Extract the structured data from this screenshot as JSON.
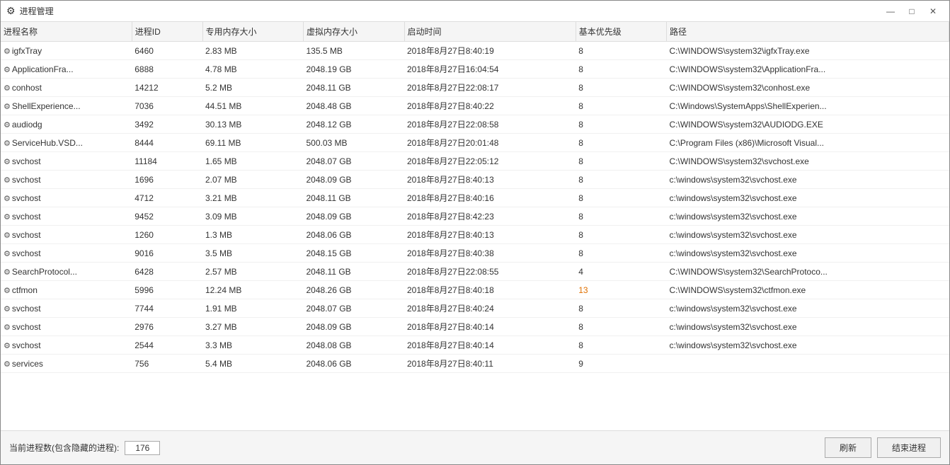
{
  "window": {
    "title": "进程管理",
    "title_icon": "⚙"
  },
  "title_controls": {
    "minimize": "—",
    "maximize": "□",
    "close": "✕"
  },
  "table": {
    "headers": [
      "进程名称",
      "进程ID",
      "专用内存大小",
      "虚拟内存大小",
      "启动时间",
      "基本优先级",
      "路径"
    ],
    "rows": [
      {
        "name": "igfxTray",
        "pid": "6460",
        "mem": "2.83 MB",
        "vmem": "135.5 MB",
        "time": "2018年8月27日8:40:19",
        "prio": "8",
        "path": "C:\\WINDOWS\\system32\\igfxTray.exe",
        "prio_class": ""
      },
      {
        "name": "ApplicationFra...",
        "pid": "6888",
        "mem": "4.78 MB",
        "vmem": "2048.19 GB",
        "time": "2018年8月27日16:04:54",
        "prio": "8",
        "path": "C:\\WINDOWS\\system32\\ApplicationFra...",
        "prio_class": ""
      },
      {
        "name": "conhost",
        "pid": "14212",
        "mem": "5.2 MB",
        "vmem": "2048.11 GB",
        "time": "2018年8月27日22:08:17",
        "prio": "8",
        "path": "C:\\WINDOWS\\system32\\conhost.exe",
        "prio_class": ""
      },
      {
        "name": "ShellExperience...",
        "pid": "7036",
        "mem": "44.51 MB",
        "vmem": "2048.48 GB",
        "time": "2018年8月27日8:40:22",
        "prio": "8",
        "path": "C:\\Windows\\SystemApps\\ShellExperien...",
        "prio_class": ""
      },
      {
        "name": "audiodg",
        "pid": "3492",
        "mem": "30.13 MB",
        "vmem": "2048.12 GB",
        "time": "2018年8月27日22:08:58",
        "prio": "8",
        "path": "C:\\WINDOWS\\system32\\AUDIODG.EXE",
        "prio_class": ""
      },
      {
        "name": "ServiceHub.VSD...",
        "pid": "8444",
        "mem": "69.11 MB",
        "vmem": "500.03 MB",
        "time": "2018年8月27日20:01:48",
        "prio": "8",
        "path": "C:\\Program Files (x86)\\Microsoft Visual...",
        "prio_class": ""
      },
      {
        "name": "svchost",
        "pid": "11184",
        "mem": "1.65 MB",
        "vmem": "2048.07 GB",
        "time": "2018年8月27日22:05:12",
        "prio": "8",
        "path": "C:\\WINDOWS\\system32\\svchost.exe",
        "prio_class": ""
      },
      {
        "name": "svchost",
        "pid": "1696",
        "mem": "2.07 MB",
        "vmem": "2048.09 GB",
        "time": "2018年8月27日8:40:13",
        "prio": "8",
        "path": "c:\\windows\\system32\\svchost.exe",
        "prio_class": ""
      },
      {
        "name": "svchost",
        "pid": "4712",
        "mem": "3.21 MB",
        "vmem": "2048.11 GB",
        "time": "2018年8月27日8:40:16",
        "prio": "8",
        "path": "c:\\windows\\system32\\svchost.exe",
        "prio_class": ""
      },
      {
        "name": "svchost",
        "pid": "9452",
        "mem": "3.09 MB",
        "vmem": "2048.09 GB",
        "time": "2018年8月27日8:42:23",
        "prio": "8",
        "path": "c:\\windows\\system32\\svchost.exe",
        "prio_class": ""
      },
      {
        "name": "svchost",
        "pid": "1260",
        "mem": "1.3 MB",
        "vmem": "2048.06 GB",
        "time": "2018年8月27日8:40:13",
        "prio": "8",
        "path": "c:\\windows\\system32\\svchost.exe",
        "prio_class": ""
      },
      {
        "name": "svchost",
        "pid": "9016",
        "mem": "3.5 MB",
        "vmem": "2048.15 GB",
        "time": "2018年8月27日8:40:38",
        "prio": "8",
        "path": "c:\\windows\\system32\\svchost.exe",
        "prio_class": ""
      },
      {
        "name": "SearchProtocol...",
        "pid": "6428",
        "mem": "2.57 MB",
        "vmem": "2048.11 GB",
        "time": "2018年8月27日22:08:55",
        "prio": "4",
        "path": "C:\\WINDOWS\\system32\\SearchProtoco...",
        "prio_class": ""
      },
      {
        "name": "ctfmon",
        "pid": "5996",
        "mem": "12.24 MB",
        "vmem": "2048.26 GB",
        "time": "2018年8月27日8:40:18",
        "prio": "13",
        "path": "C:\\WINDOWS\\system32\\ctfmon.exe",
        "prio_class": "orange"
      },
      {
        "name": "svchost",
        "pid": "7744",
        "mem": "1.91 MB",
        "vmem": "2048.07 GB",
        "time": "2018年8月27日8:40:24",
        "prio": "8",
        "path": "c:\\windows\\system32\\svchost.exe",
        "prio_class": ""
      },
      {
        "name": "svchost",
        "pid": "2976",
        "mem": "3.27 MB",
        "vmem": "2048.09 GB",
        "time": "2018年8月27日8:40:14",
        "prio": "8",
        "path": "c:\\windows\\system32\\svchost.exe",
        "prio_class": ""
      },
      {
        "name": "svchost",
        "pid": "2544",
        "mem": "3.3 MB",
        "vmem": "2048.08 GB",
        "time": "2018年8月27日8:40:14",
        "prio": "8",
        "path": "c:\\windows\\system32\\svchost.exe",
        "prio_class": ""
      },
      {
        "name": "services",
        "pid": "756",
        "mem": "5.4 MB",
        "vmem": "2048.06 GB",
        "time": "2018年8月27日8:40:11",
        "prio": "9",
        "path": "",
        "prio_class": ""
      }
    ]
  },
  "footer": {
    "label": "当前进程数(包含隐藏的进程):",
    "count": "176",
    "refresh_btn": "刷新",
    "kill_btn": "结束进程"
  }
}
